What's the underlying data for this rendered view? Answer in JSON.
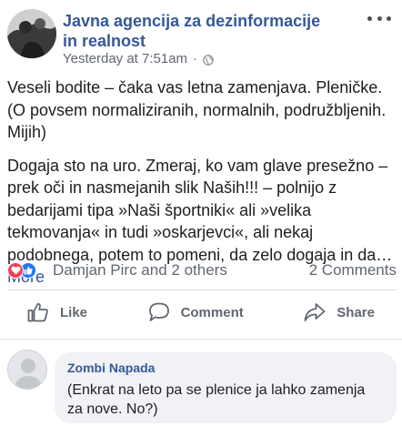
{
  "post": {
    "page_name": "Javna agencija za dezinformacije in realnost",
    "timestamp": "Yesterday at 7:51am",
    "separator": "·",
    "paragraph1": "Veseli bodite – čaka vas letna zamenjava. Pleničke. (O povsem normaliziranih, normalnih, podružbljenih. Mijih)",
    "paragraph2": "Dogaja sto na uro. Zmeraj, ko vam glave presežno – prek oči in nasmejanih slik Naših!!! – polnijo z bedarijami tipa »Naši športniki« ali »velika tekmovanja« in tudi »oskarjevci«, ali nekaj podobnega, potem to pomeni, da zelo dogaja in da…",
    "more_label": "More"
  },
  "stats": {
    "reactors": "Damjan Pirc and 2 others",
    "comments": "2 Comments"
  },
  "actions": {
    "like": "Like",
    "comment": "Comment",
    "share": "Share"
  },
  "comment": {
    "author": "Zombi Napada",
    "text": "(Enkrat na leto pa se plenice ja lahko zamenja za nove. No?)"
  },
  "icons": {
    "globe": "globe-icon",
    "more": "more-options-icon",
    "love": "love-reaction-icon",
    "like_reaction": "like-reaction-icon",
    "like": "thumbs-up-icon",
    "comment": "speech-bubble-icon",
    "share": "share-arrow-icon"
  },
  "colors": {
    "link": "#365899",
    "love": "#f33e58",
    "like": "#2078f4",
    "muted": "#606770"
  }
}
